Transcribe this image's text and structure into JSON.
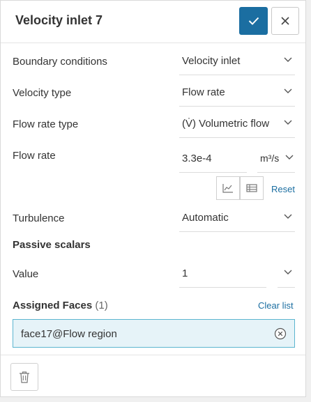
{
  "header": {
    "title": "Velocity inlet 7",
    "confirm_icon": "check-icon",
    "close_icon": "close-icon",
    "accent_color": "#1b6ea1"
  },
  "fields": {
    "boundary_conditions": {
      "label": "Boundary conditions",
      "value": "Velocity inlet"
    },
    "velocity_type": {
      "label": "Velocity type",
      "value": "Flow rate"
    },
    "flow_rate_type": {
      "label": "Flow rate type",
      "value": "(V̇) Volumetric flow"
    },
    "flow_rate": {
      "label": "Flow rate",
      "value": "3.3e-4",
      "unit": "m³/s"
    },
    "flow_rate_actions": {
      "chart_icon": "chart-icon",
      "table_icon": "table-icon",
      "reset_label": "Reset"
    },
    "turbulence": {
      "label": "Turbulence",
      "value": "Automatic"
    }
  },
  "passive_scalars": {
    "heading": "Passive scalars",
    "value_label": "Value",
    "value": "1"
  },
  "assigned_faces": {
    "heading": "Assigned Faces",
    "count": "(1)",
    "clear_label": "Clear list",
    "items": [
      "face17@Flow region"
    ],
    "highlight_color": "#e6f3f8"
  },
  "footer": {
    "delete_icon": "trash-icon"
  }
}
